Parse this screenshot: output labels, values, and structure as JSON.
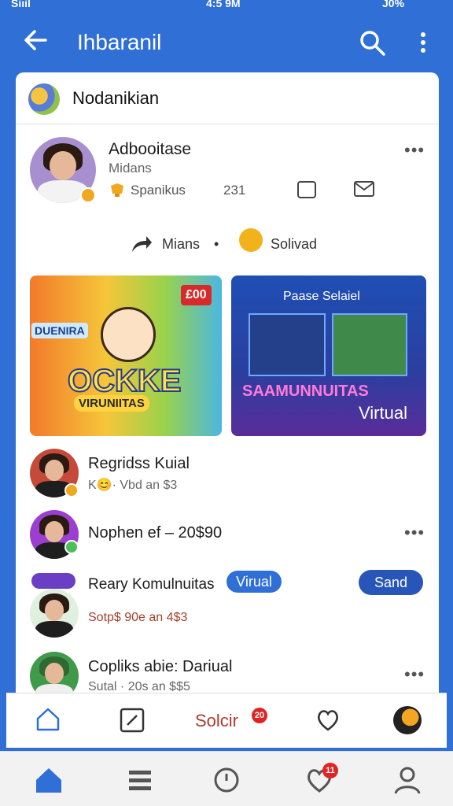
{
  "status": {
    "signal": "Siıil",
    "time": "4:5 9M",
    "battery": "J0%"
  },
  "app_bar": {
    "title": "Ihbaranil"
  },
  "card": {
    "title": "Nodanikian"
  },
  "profile": {
    "name": "Adbooitase",
    "subtitle": "Midans",
    "reward_label": "Spanikus",
    "count": "231"
  },
  "actions": {
    "share_label": "Mians",
    "solved_label": "Solivad"
  },
  "banners": [
    {
      "tag": "DUENIRA",
      "badge": "£00",
      "headline": "OCKKE",
      "subline": "VIRUNIITAS"
    },
    {
      "title": "Paase Selaiel",
      "headline": "SAAMUNNUITAS",
      "subline": "Virtual"
    }
  ],
  "feed": [
    {
      "name": "Regridss Kuial",
      "meta": "K😊· Vbd an $3"
    },
    {
      "name": "Nophen ef – 20$90",
      "meta": ""
    },
    {
      "name": "Reary Komulnuitas",
      "tag": "Virual",
      "meta": "Sotp$ 90e an 4$3",
      "button": "Sand"
    },
    {
      "name": "Copliks abie: Dariual",
      "meta": "Sutal · 20s an $$5"
    }
  ],
  "inner_tabs": {
    "label": "Solcir",
    "count": "20"
  },
  "bottom_nav": {
    "heart_count": "11"
  },
  "colors": {
    "brand": "#2f6fd6",
    "accent_pill": "#2855b8",
    "notif": "#e02424"
  }
}
